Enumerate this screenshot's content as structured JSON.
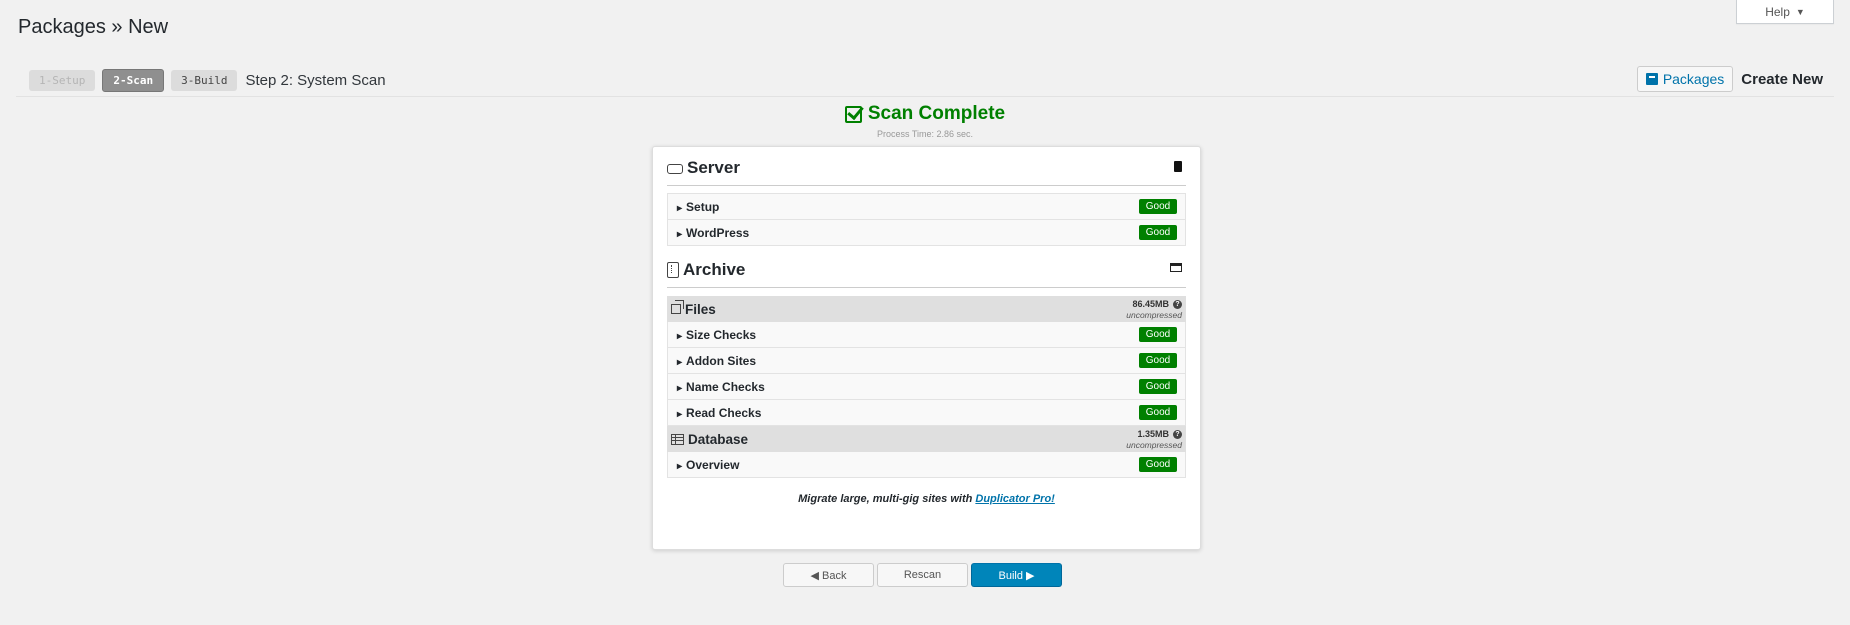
{
  "help": {
    "label": "Help",
    "caret": "▼"
  },
  "page_title": "Packages » New",
  "steps": [
    {
      "label": "1-Setup",
      "state": "done"
    },
    {
      "label": "2-Scan",
      "state": "active"
    },
    {
      "label": "3-Build",
      "state": "pending"
    }
  ],
  "step_title": "Step 2: System Scan",
  "top_actions": {
    "packages_label": "Packages",
    "create_new_label": "Create New"
  },
  "scan": {
    "title": "Scan Complete",
    "process_time": "Process Time: 2.86 sec."
  },
  "server": {
    "title": "Server",
    "rows": [
      {
        "label": "Setup",
        "status": "Good"
      },
      {
        "label": "WordPress",
        "status": "Good"
      }
    ]
  },
  "archive": {
    "title": "Archive",
    "files": {
      "title": "Files",
      "size": "86.45MB",
      "size_note": "uncompressed",
      "rows": [
        {
          "label": "Size Checks",
          "status": "Good"
        },
        {
          "label": "Addon Sites",
          "status": "Good"
        },
        {
          "label": "Name Checks",
          "status": "Good"
        },
        {
          "label": "Read Checks",
          "status": "Good"
        }
      ]
    },
    "database": {
      "title": "Database",
      "size": "1.35MB",
      "size_note": "uncompressed",
      "rows": [
        {
          "label": "Overview",
          "status": "Good"
        }
      ]
    }
  },
  "promo": {
    "text": "Migrate large, multi-gig sites with ",
    "link": "Duplicator Pro!"
  },
  "buttons": {
    "back": "◀ Back",
    "rescan": "Rescan",
    "build": "Build ▶"
  },
  "colors": {
    "good": "#008000",
    "primary": "#0085ba",
    "link": "#0073aa",
    "scan_complete": "#008000"
  }
}
